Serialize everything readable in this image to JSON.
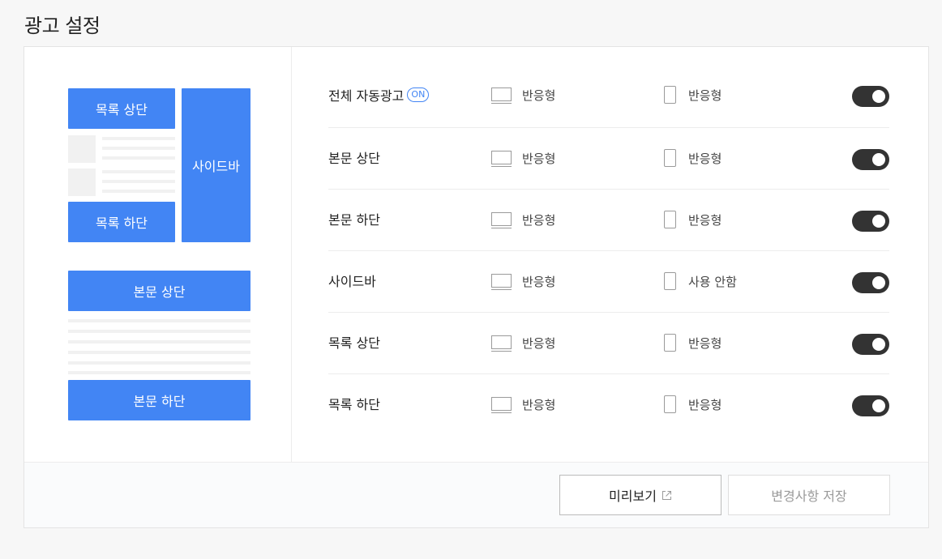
{
  "page": {
    "title": "광고 설정"
  },
  "preview_layout": {
    "list_top": "목록 상단",
    "sidebar": "사이드바",
    "list_bottom": "목록 하단",
    "body_top": "본문 상단",
    "body_bottom": "본문 하단"
  },
  "ad_rows": [
    {
      "label": "전체 자동광고",
      "badge": "ON",
      "desktop": "반응형",
      "mobile": "반응형",
      "enabled": true
    },
    {
      "label": "본문 상단",
      "desktop": "반응형",
      "mobile": "반응형",
      "enabled": true
    },
    {
      "label": "본문 하단",
      "desktop": "반응형",
      "mobile": "반응형",
      "enabled": true
    },
    {
      "label": "사이드바",
      "desktop": "반응형",
      "mobile": "사용 안함",
      "enabled": true
    },
    {
      "label": "목록 상단",
      "desktop": "반응형",
      "mobile": "반응형",
      "enabled": true
    },
    {
      "label": "목록 하단",
      "desktop": "반응형",
      "mobile": "반응형",
      "enabled": true
    }
  ],
  "footer": {
    "preview_label": "미리보기",
    "save_label": "변경사항 저장"
  },
  "colors": {
    "accent": "#4285f4",
    "toggle_on": "#333333"
  },
  "icons": {
    "desktop": "monitor-icon",
    "mobile": "phone-icon",
    "external": "external-link-icon"
  }
}
